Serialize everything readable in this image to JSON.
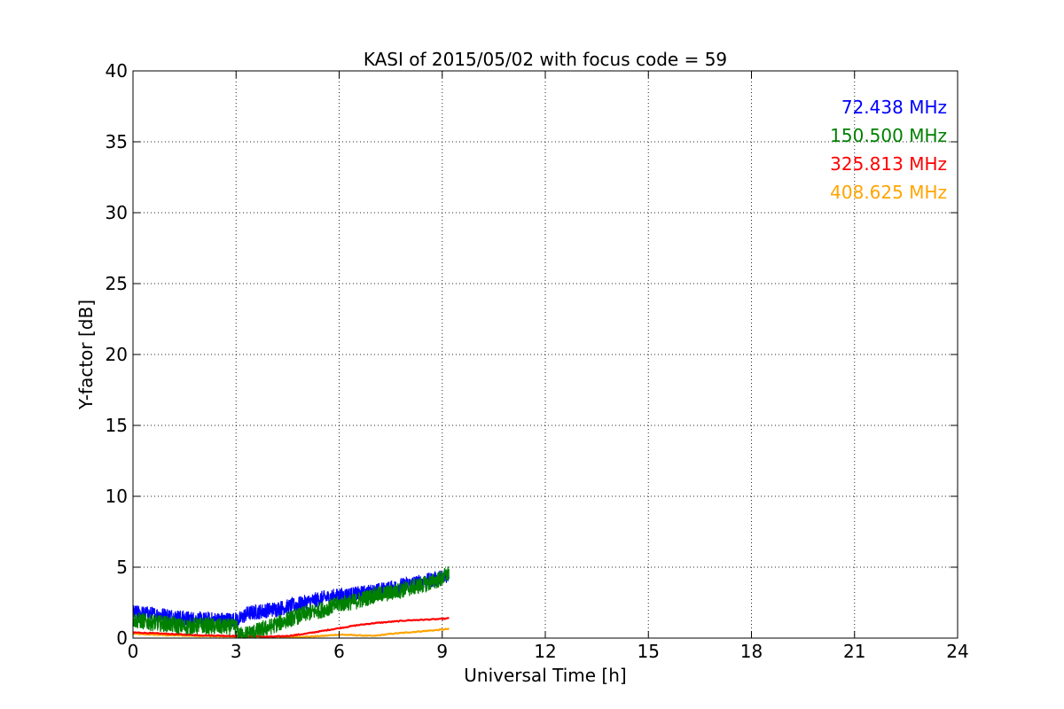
{
  "chart_data": {
    "type": "line",
    "title": "KASI of 2015/05/02 with focus code = 59",
    "xlabel": "Universal Time [h]",
    "ylabel": "Y-factor [dB]",
    "xlim": [
      0,
      24
    ],
    "ylim": [
      0,
      40
    ],
    "xticks": [
      "0",
      "3",
      "6",
      "9",
      "12",
      "15",
      "18",
      "21",
      "24"
    ],
    "yticks": [
      "0",
      "5",
      "10",
      "15",
      "20",
      "25",
      "30",
      "35",
      "40"
    ],
    "grid": true,
    "legend_placement": "top-right",
    "series": [
      {
        "name": "72.438 MHz",
        "color": "#0000ff",
        "noise": 0.55,
        "x": [
          0,
          0.5,
          1.0,
          1.5,
          2.0,
          2.5,
          3.0,
          3.1,
          3.3,
          3.5,
          4.0,
          4.5,
          5.0,
          5.5,
          6.0,
          6.5,
          7.0,
          7.5,
          8.0,
          8.5,
          9.0,
          9.2
        ],
        "y": [
          1.8,
          1.7,
          1.6,
          1.4,
          1.3,
          1.3,
          1.3,
          1.3,
          1.7,
          1.8,
          2.0,
          2.2,
          2.5,
          2.8,
          3.0,
          3.1,
          3.3,
          3.5,
          3.8,
          4.0,
          4.3,
          4.5
        ]
      },
      {
        "name": "150.500 MHz",
        "color": "#008000",
        "noise": 0.6,
        "x": [
          0,
          0.5,
          1.0,
          1.5,
          2.0,
          2.5,
          3.0,
          3.1,
          3.5,
          4.0,
          4.5,
          5.0,
          5.5,
          6.0,
          6.5,
          7.0,
          7.5,
          8.0,
          8.5,
          9.0,
          9.2
        ],
        "y": [
          1.3,
          1.1,
          1.0,
          0.8,
          0.9,
          0.8,
          0.8,
          0.2,
          0.4,
          0.8,
          1.3,
          1.7,
          2.0,
          2.4,
          2.6,
          3.0,
          3.2,
          3.5,
          3.8,
          4.2,
          4.6
        ]
      },
      {
        "name": "325.813 MHz",
        "color": "#ff0000",
        "noise": 0.03,
        "x": [
          0,
          0.5,
          1.0,
          2.0,
          3.0,
          4.0,
          4.5,
          5.0,
          5.5,
          6.0,
          6.5,
          7.0,
          7.5,
          8.0,
          8.5,
          9.0,
          9.2
        ],
        "y": [
          0.4,
          0.35,
          0.3,
          0.2,
          0.15,
          0.1,
          0.15,
          0.3,
          0.5,
          0.7,
          0.9,
          1.05,
          1.15,
          1.25,
          1.3,
          1.35,
          1.4
        ]
      },
      {
        "name": "408.625 MHz",
        "color": "#ffa500",
        "noise": 0.03,
        "x": [
          0,
          0.5,
          1.0,
          2.0,
          3.0,
          4.0,
          5.0,
          5.5,
          6.0,
          6.5,
          7.0,
          7.5,
          8.0,
          8.5,
          9.0,
          9.2
        ],
        "y": [
          0.3,
          0.25,
          0.2,
          0.15,
          0.1,
          0.05,
          0.1,
          0.15,
          0.25,
          0.2,
          0.15,
          0.3,
          0.4,
          0.5,
          0.6,
          0.65
        ]
      }
    ]
  }
}
